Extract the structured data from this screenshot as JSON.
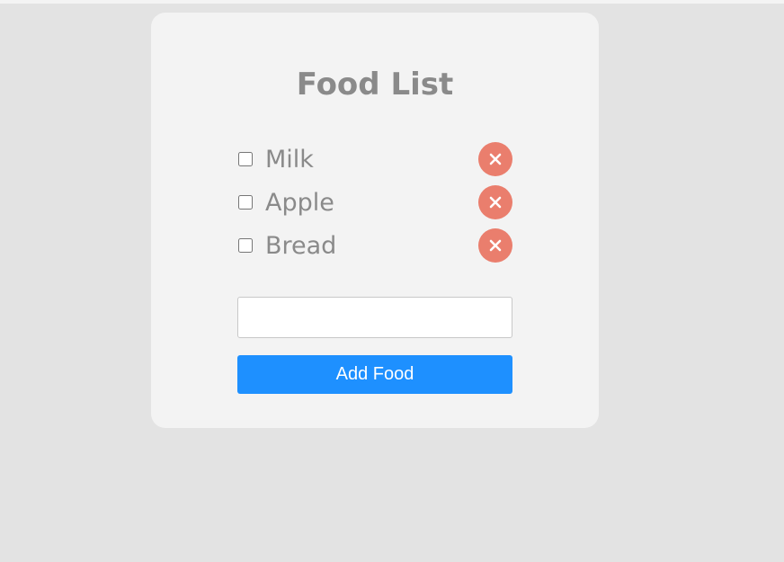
{
  "title": "Food List",
  "items": [
    {
      "label": "Milk",
      "checked": false,
      "remove_icon": "close-icon"
    },
    {
      "label": "Apple",
      "checked": false,
      "remove_icon": "close-icon"
    },
    {
      "label": "Bread",
      "checked": false,
      "remove_icon": "close-icon"
    }
  ],
  "input": {
    "value": "",
    "placeholder": ""
  },
  "add_button": {
    "label": "Add Food"
  },
  "colors": {
    "page_background": "#e3e3e3",
    "card_background": "#f3f3f3",
    "text": "#8a8a8a",
    "remove_button": "#ea7e6d",
    "add_button": "#1e90ff"
  }
}
